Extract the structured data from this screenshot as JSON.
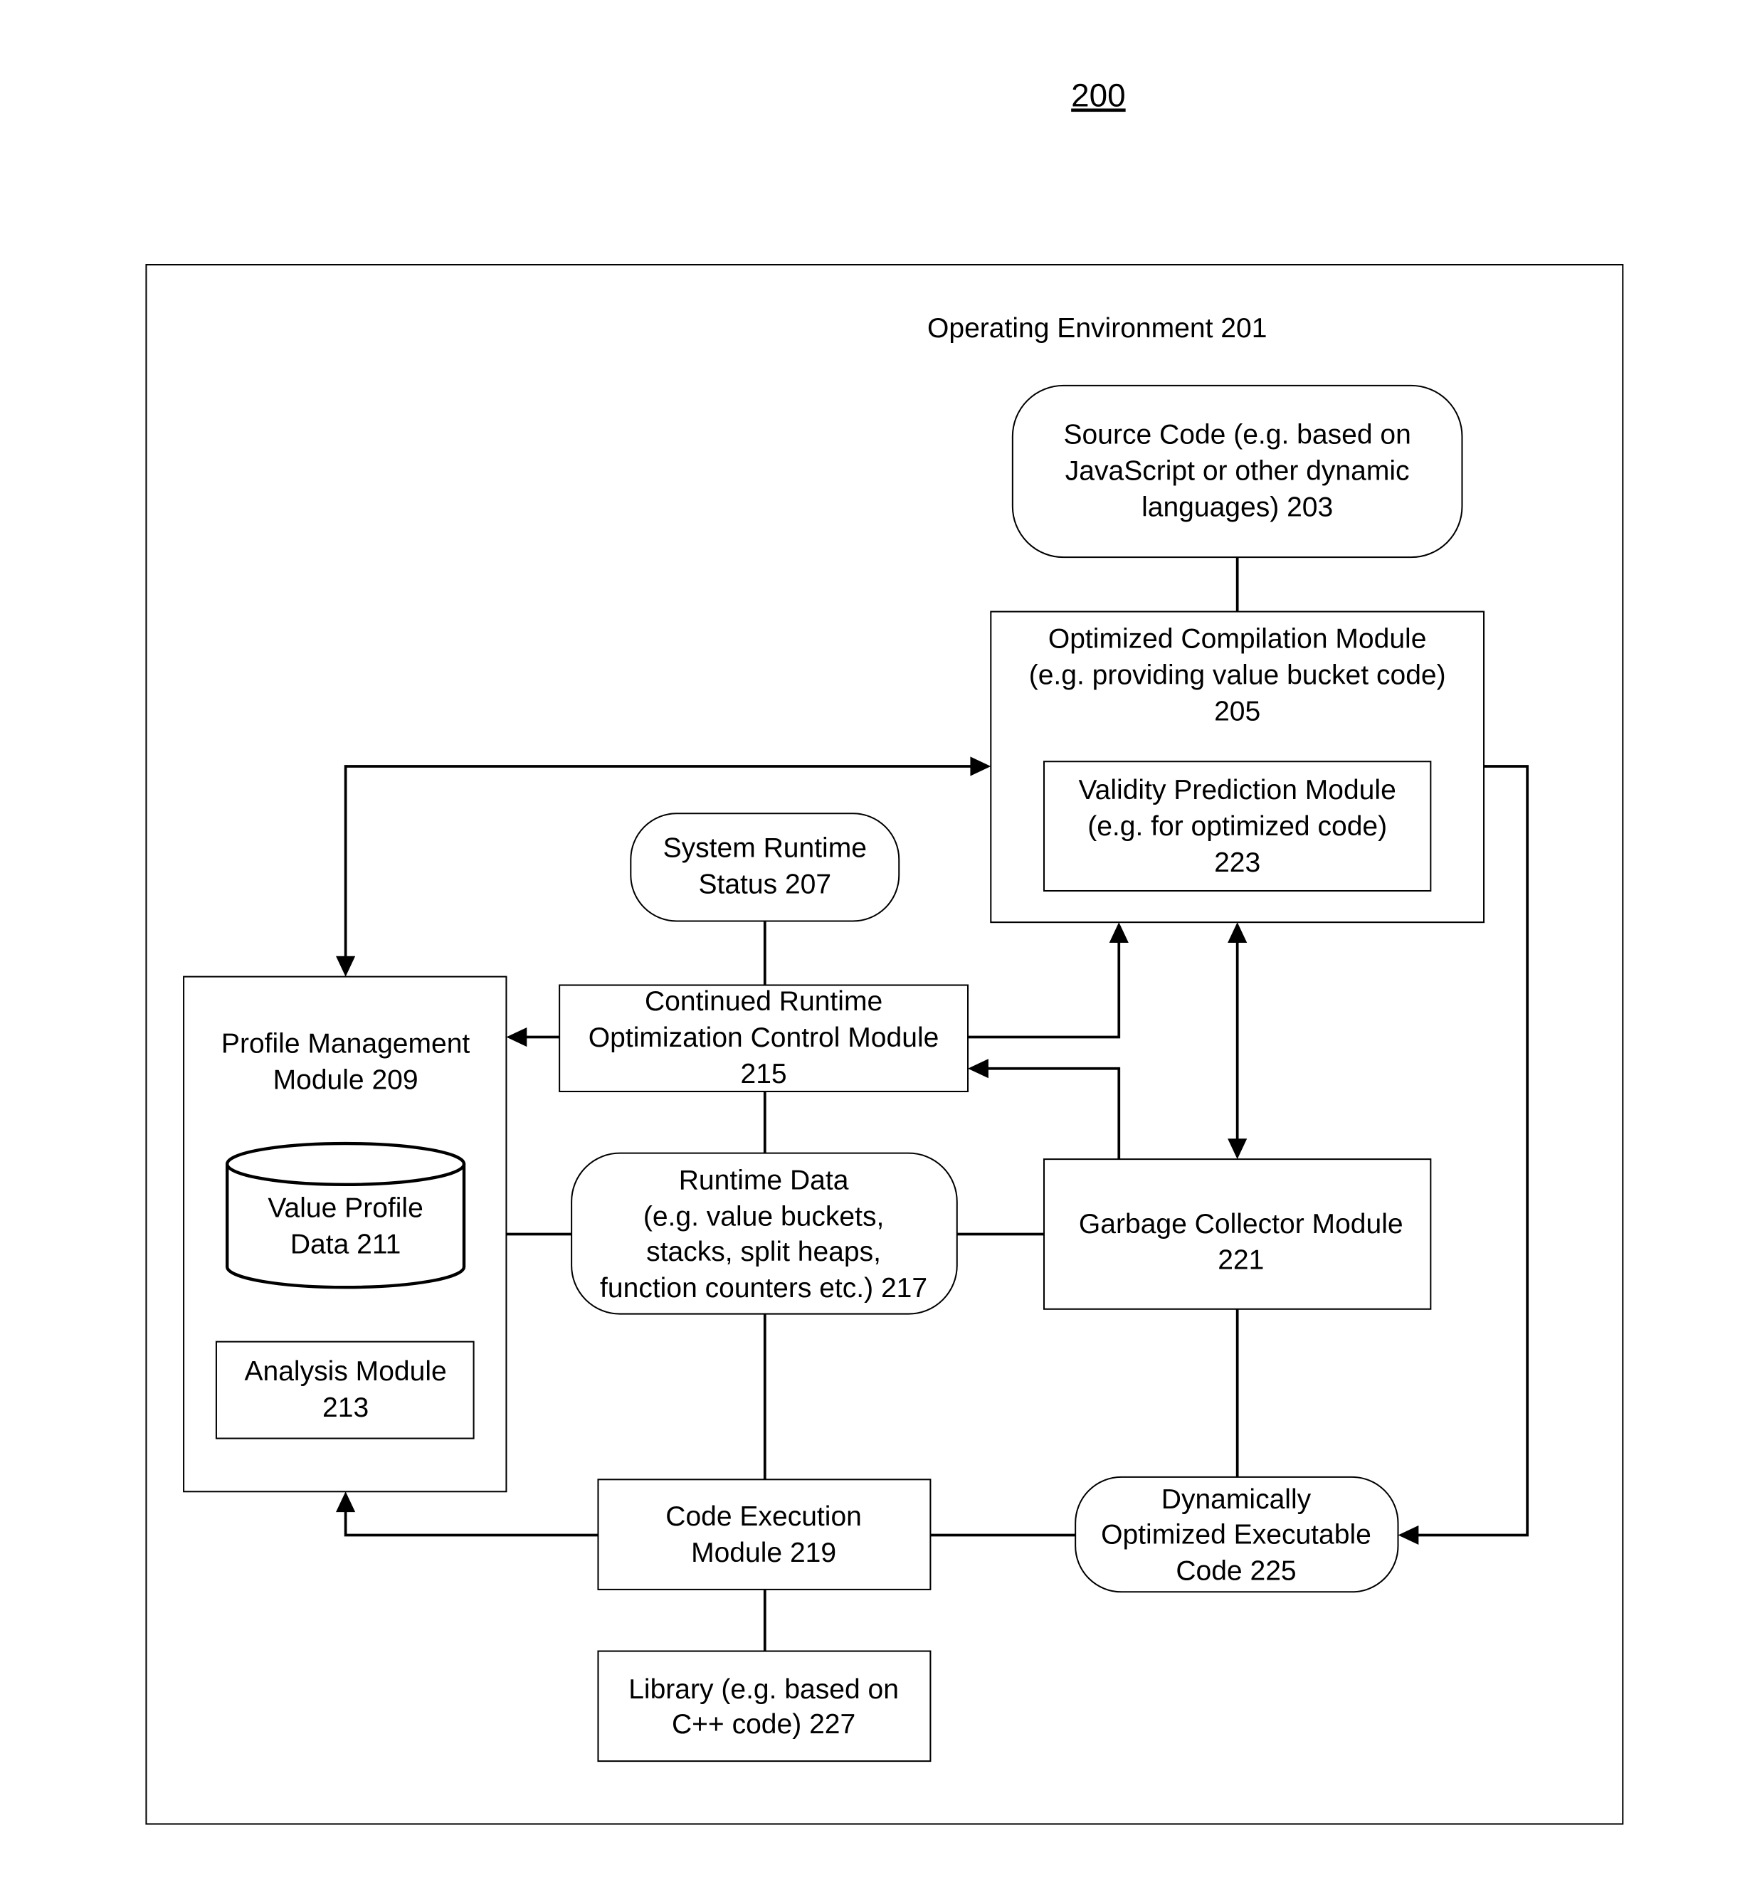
{
  "figure_number": "200",
  "environment": {
    "label": "Operating Environment 201"
  },
  "nodes": {
    "source_code": {
      "lines": [
        "Source Code (e.g. based on",
        "JavaScript or other dynamic",
        "languages)  203"
      ],
      "shape": "rounded-rect"
    },
    "optimized_compilation": {
      "lines": [
        "Optimized Compilation Module",
        "(e.g. providing value bucket code)",
        "205"
      ],
      "shape": "rect"
    },
    "validity_prediction": {
      "lines": [
        "Validity Prediction Module",
        "(e.g. for optimized code)",
        "223"
      ],
      "shape": "rect"
    },
    "system_runtime_status": {
      "lines": [
        "System Runtime",
        "Status 207"
      ],
      "shape": "rounded-rect"
    },
    "profile_management": {
      "lines": [
        "Profile Management",
        "Module 209"
      ],
      "shape": "rect"
    },
    "value_profile_data": {
      "lines": [
        "Value Profile",
        "Data 211"
      ],
      "shape": "cylinder"
    },
    "analysis_module": {
      "lines": [
        "Analysis Module",
        "213"
      ],
      "shape": "rect"
    },
    "continued_runtime": {
      "lines": [
        "Continued Runtime",
        "Optimization Control Module",
        "215"
      ],
      "shape": "rect"
    },
    "runtime_data": {
      "lines": [
        "Runtime Data",
        "(e.g. value buckets,",
        "stacks, split heaps,",
        "function counters etc.) 217"
      ],
      "shape": "rounded-rect"
    },
    "garbage_collector": {
      "lines": [
        "Garbage Collector Module",
        "221"
      ],
      "shape": "rect"
    },
    "code_execution": {
      "lines": [
        "Code Execution",
        "Module  219"
      ],
      "shape": "rect"
    },
    "dynamically_optimized": {
      "lines": [
        "Dynamically",
        "Optimized Executable",
        "Code 225"
      ],
      "shape": "rounded-rect"
    },
    "library": {
      "lines": [
        "Library (e.g. based on",
        "C++ code) 227"
      ],
      "shape": "rect"
    }
  },
  "edges": [
    {
      "from": "source_code",
      "to": "optimized_compilation",
      "arrow": "none"
    },
    {
      "from": "optimized_compilation",
      "to": "profile_management",
      "arrow": "both"
    },
    {
      "from": "optimized_compilation",
      "to": "dynamically_optimized",
      "arrow": "end"
    },
    {
      "from": "system_runtime_status",
      "to": "continued_runtime",
      "arrow": "none"
    },
    {
      "from": "continued_runtime",
      "to": "profile_management",
      "arrow": "end"
    },
    {
      "from": "continued_runtime",
      "to": "optimized_compilation",
      "arrow": "end"
    },
    {
      "from": "garbage_collector",
      "to": "continued_runtime",
      "arrow": "end"
    },
    {
      "from": "optimized_compilation",
      "to": "garbage_collector",
      "arrow": "both"
    },
    {
      "from": "continued_runtime",
      "to": "runtime_data",
      "arrow": "none"
    },
    {
      "from": "profile_management",
      "to": "runtime_data",
      "arrow": "none"
    },
    {
      "from": "runtime_data",
      "to": "garbage_collector",
      "arrow": "none"
    },
    {
      "from": "runtime_data",
      "to": "code_execution",
      "arrow": "none"
    },
    {
      "from": "garbage_collector",
      "to": "dynamically_optimized",
      "arrow": "none"
    },
    {
      "from": "code_execution",
      "to": "profile_management",
      "arrow": "end"
    },
    {
      "from": "code_execution",
      "to": "dynamically_optimized",
      "arrow": "none"
    },
    {
      "from": "code_execution",
      "to": "library",
      "arrow": "none"
    }
  ]
}
